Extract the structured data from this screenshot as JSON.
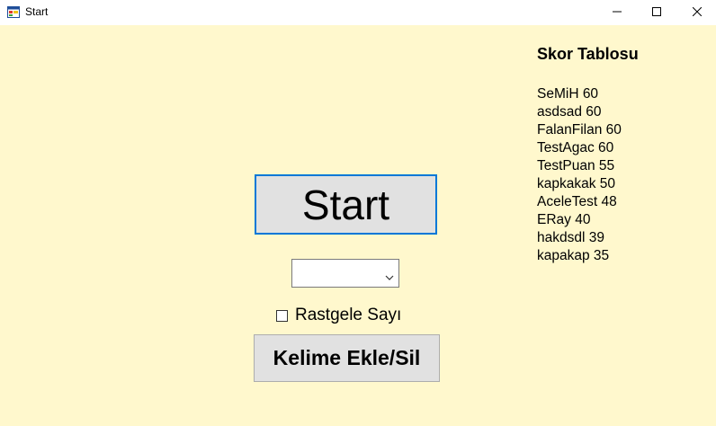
{
  "window": {
    "title": "Start",
    "app_icon": "winforms-app-icon",
    "controls": {
      "minimize_icon": "minimize-icon",
      "maximize_icon": "maximize-icon",
      "close_icon": "close-icon"
    },
    "background_color": "#fff8cd"
  },
  "main": {
    "start_button_label": "Start",
    "combo": {
      "selected_value": "",
      "arrow_icon": "chevron-down-icon"
    },
    "random_checkbox": {
      "label": "Rastgele Sayı",
      "checked": false
    },
    "word_button_label": "Kelime Ekle/Sil"
  },
  "scoreboard": {
    "title": "Skor Tablosu",
    "entries": [
      "SeMiH 60",
      "asdsad 60",
      "FalanFilan 60",
      "TestAgac 60",
      "TestPuan 55",
      "kapkakak 50",
      "AceleTest 48",
      "ERay 40",
      "hakdsdl 39",
      "kapakap 35"
    ]
  }
}
